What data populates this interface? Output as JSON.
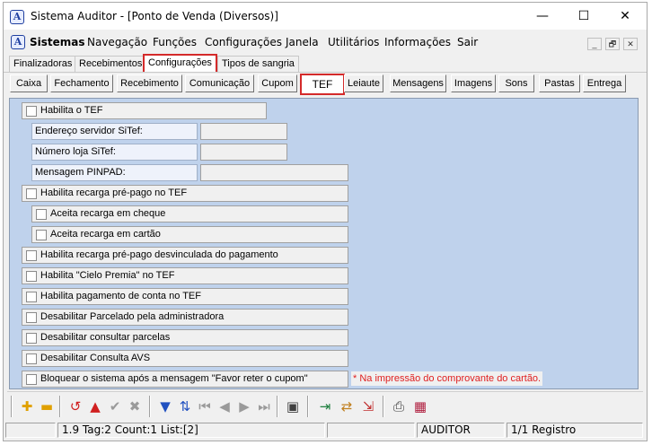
{
  "window": {
    "title": "Sistema Auditor - [Ponto de Venda (Diversos)]",
    "controls": {
      "minimize": "—",
      "maximize": "☐",
      "close": "✕"
    }
  },
  "menubar": {
    "items": [
      "Sistemas",
      "Navegação",
      "Funções",
      "Configurações",
      "Janela",
      "Utilitários",
      "Informações",
      "Sair"
    ],
    "mdi_controls": [
      "_",
      "🗗",
      "✕"
    ]
  },
  "primary_tabs": [
    "Finalizadoras",
    "Recebimentos",
    "Configurações",
    "Tipos de sangria"
  ],
  "primary_active": "Configurações",
  "secondary_tabs": [
    "Caixa",
    "Fechamento",
    "Recebimento",
    "Comunicação",
    "Cupom",
    "TEF",
    "Leiaute",
    "Mensagens",
    "Imagens",
    "Sons",
    "Pastas",
    "Entrega"
  ],
  "secondary_active": "TEF",
  "form": {
    "habilita_tef": "Habilita o TEF",
    "endereco_label": "Endereço servidor SiTef:",
    "endereco_value": "",
    "numero_loja_label": "Número loja SiTef:",
    "numero_loja_value": "",
    "mensagem_pinpad_label": "Mensagem PINPAD:",
    "mensagem_pinpad_value": "",
    "recarga_prepago": "Habilita recarga pré-pago no TEF",
    "aceita_cheque": "Aceita recarga em cheque",
    "aceita_cartao": "Aceita recarga em cartão",
    "recarga_desvinculada": "Habilita recarga pré-pago desvinculada do pagamento",
    "cielo_premia": "Habilita \"Cielo Premia\" no TEF",
    "pagamento_conta": "Habilita pagamento de conta no TEF",
    "desabilitar_parcelado": "Desabilitar Parcelado pela administradora",
    "desabilitar_consultar_parcelas": "Desabilitar consultar parcelas",
    "desabilitar_avs": "Desabilitar Consulta AVS",
    "bloquear_sistema": "Bloquear o sistema após a mensagem \"Favor reter o cupom\"",
    "bloquear_note": "* Na impressão do comprovante do cartão."
  },
  "toolbar": {
    "icons": [
      "add-icon",
      "remove-icon",
      "undo-icon",
      "alert-icon",
      "confirm-icon",
      "cancel-icon",
      "filter-icon",
      "sort-icon",
      "first-icon",
      "prev-icon",
      "next-icon",
      "last-icon",
      "window-icon",
      "export-icon",
      "import-icon",
      "transfer-icon",
      "print-icon",
      "calendar-icon"
    ]
  },
  "statusbar": {
    "cell1": "",
    "info": "1.9 Tag:2 Count:1 List:[2]",
    "cell3": "",
    "user": "AUDITOR",
    "record": "1/1 Registro"
  }
}
